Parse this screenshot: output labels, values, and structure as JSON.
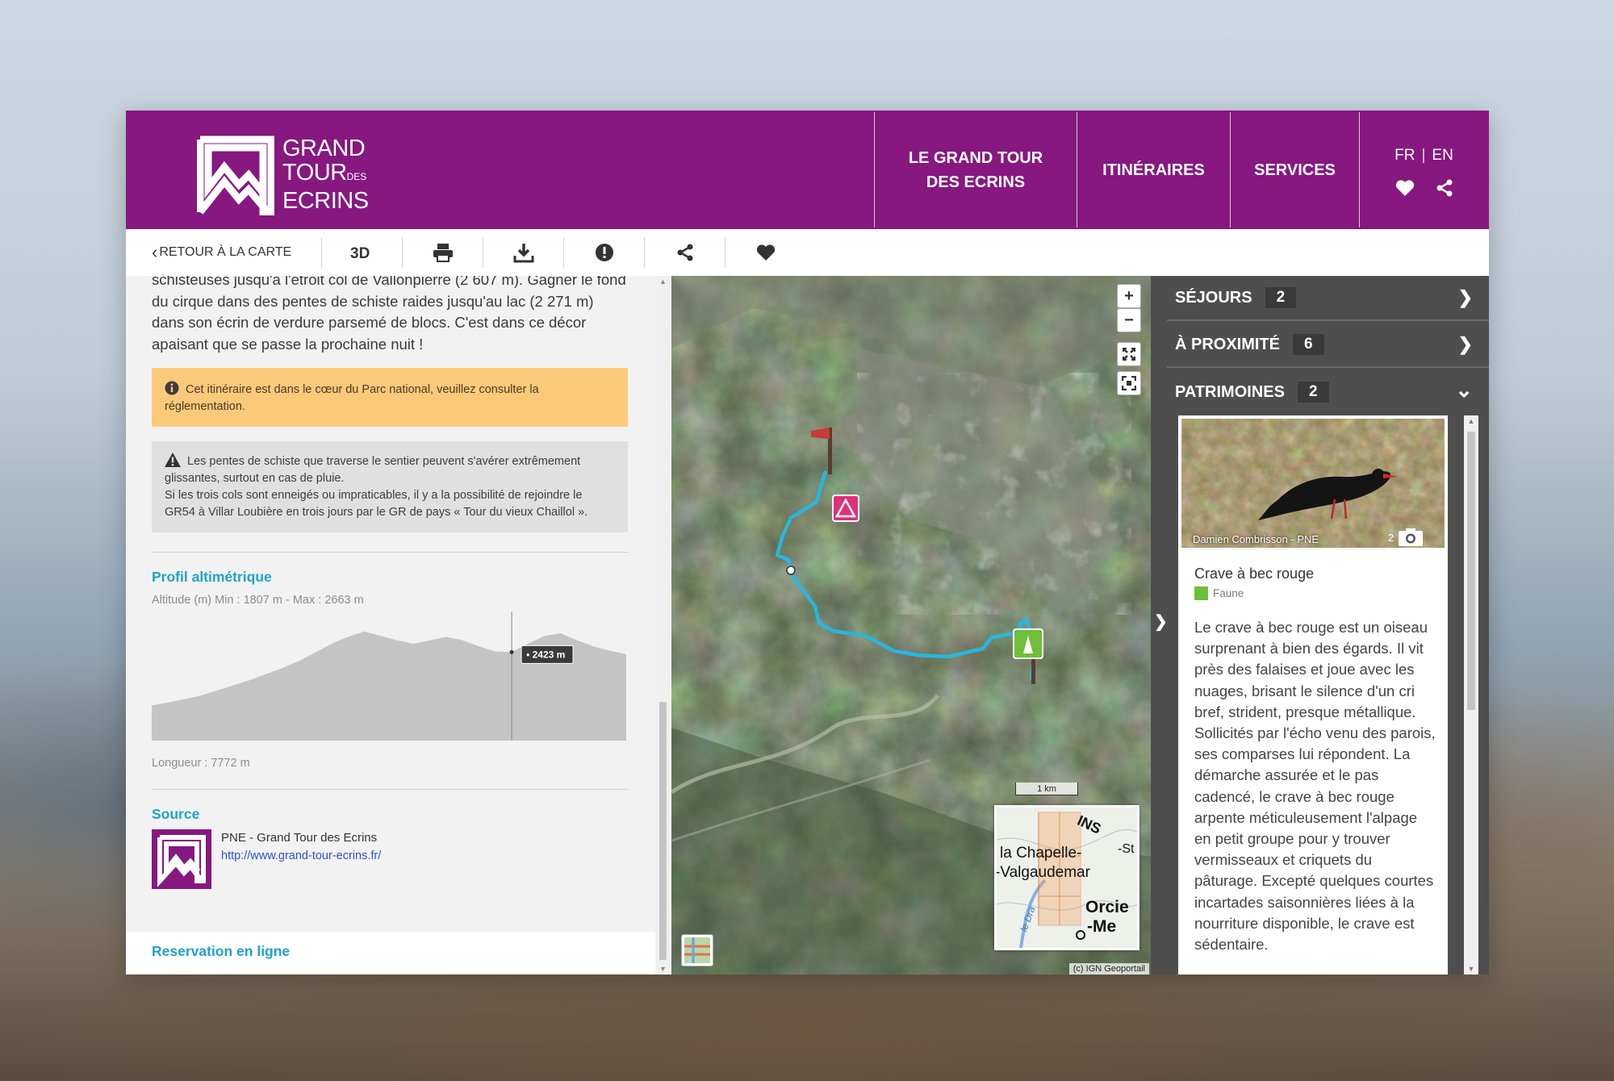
{
  "header": {
    "logo": {
      "line1": "GRAND",
      "line2": "TOUR",
      "des": "DES",
      "line3": "ECRINS"
    },
    "nav": [
      {
        "label": "LE GRAND TOUR DES ECRINS"
      },
      {
        "label": "ITINÉRAIRES"
      },
      {
        "label": "SERVICES"
      }
    ],
    "lang": {
      "fr": "FR",
      "sep": "|",
      "en": "EN"
    },
    "icons": [
      "heart-icon",
      "share-icon"
    ]
  },
  "toolbar": {
    "back_label": "RETOUR À LA CARTE",
    "buttons": [
      "3d-icon",
      "print-icon",
      "download-icon",
      "alert-icon",
      "share-icon",
      "heart-icon"
    ]
  },
  "left": {
    "description": "schisteuses jusqu'à l'étroit col de Vallonpierre (2 607 m). Gagner le fond du cirque dans des pentes de schiste raides jusqu'au lac (2  271 m) dans son écrin de verdure parsemé de blocs. C'est dans ce décor apaisant que se passe la prochaine nuit !",
    "notice_orange": "Cet itinéraire est dans le cœur du Parc national, veuillez consulter la réglementation.",
    "notice_grey_1": "Les pentes de schiste que traverse le sentier peuvent s'avérer extrêmement glissantes, surtout en cas de pluie.",
    "notice_grey_2": "Si les trois cols sont enneigés ou impraticables, il y a la possibilité de rejoindre le GR54 à Villar Loubière en trois jours par le GR de pays « Tour du vieux Chaillol ».",
    "profile": {
      "title": "Profil altimétrique",
      "meta": "Altitude (m) Min : 1807 m - Max : 2663 m",
      "tooltip": "2423 m",
      "length": "Longueur : 7772 m",
      "elevations": [
        1807,
        1840,
        1880,
        1920,
        1980,
        2040,
        2100,
        2170,
        2240,
        2320,
        2420,
        2520,
        2600,
        2663,
        2610,
        2560,
        2520,
        2560,
        2600,
        2560,
        2490,
        2430,
        2423,
        2520,
        2610,
        2640,
        2560,
        2490,
        2440,
        2400
      ]
    },
    "source": {
      "title": "Source",
      "name": "PNE - Grand Tour des Ecrins",
      "link": "http://www.grand-tour-ecrins.fr/"
    },
    "reservation": "Reservation en ligne"
  },
  "map": {
    "zoom_in": "+",
    "zoom_out": "−",
    "scale": "1 km",
    "attribution": "(c) IGN Geoportail",
    "minimap_labels": [
      "la Chapelle-",
      "-Valgaudemar",
      "Orcie",
      "-Me",
      "INS",
      "-St",
      "le Dra"
    ]
  },
  "right": {
    "accordions": [
      {
        "label": "SÉJOURS",
        "count": "2",
        "arrow": "❯"
      },
      {
        "label": "À PROXIMITÉ",
        "count": "6",
        "arrow": "❯"
      },
      {
        "label": "PATRIMOINES",
        "count": "2",
        "arrow": "⌄"
      }
    ],
    "card": {
      "credit": "Damien Combrisson - PNE",
      "photo_count": "2",
      "title": "Crave à bec rouge",
      "category": "Faune",
      "body": "Le crave à bec rouge est un oiseau surprenant à bien des égards. Il vit près des falaises et joue avec les nuages, brisant le silence d'un cri bref, strident, presque métallique. Sollicités par l'écho venu des parois, ses comparses lui répondent. La démarche assurée et le pas cadencé, le crave à bec rouge arpente méticuleusement l'alpage en petit groupe pour y trouver vermisseaux et criquets du pâturage. Excepté quelques courtes incartades saisonnières liées à la nourriture disponible, le crave est sédentaire."
    }
  },
  "colors": {
    "brand": "#86187f",
    "accent": "#20a3c6",
    "route": "#29b6de",
    "warning": "#fbc97a"
  }
}
